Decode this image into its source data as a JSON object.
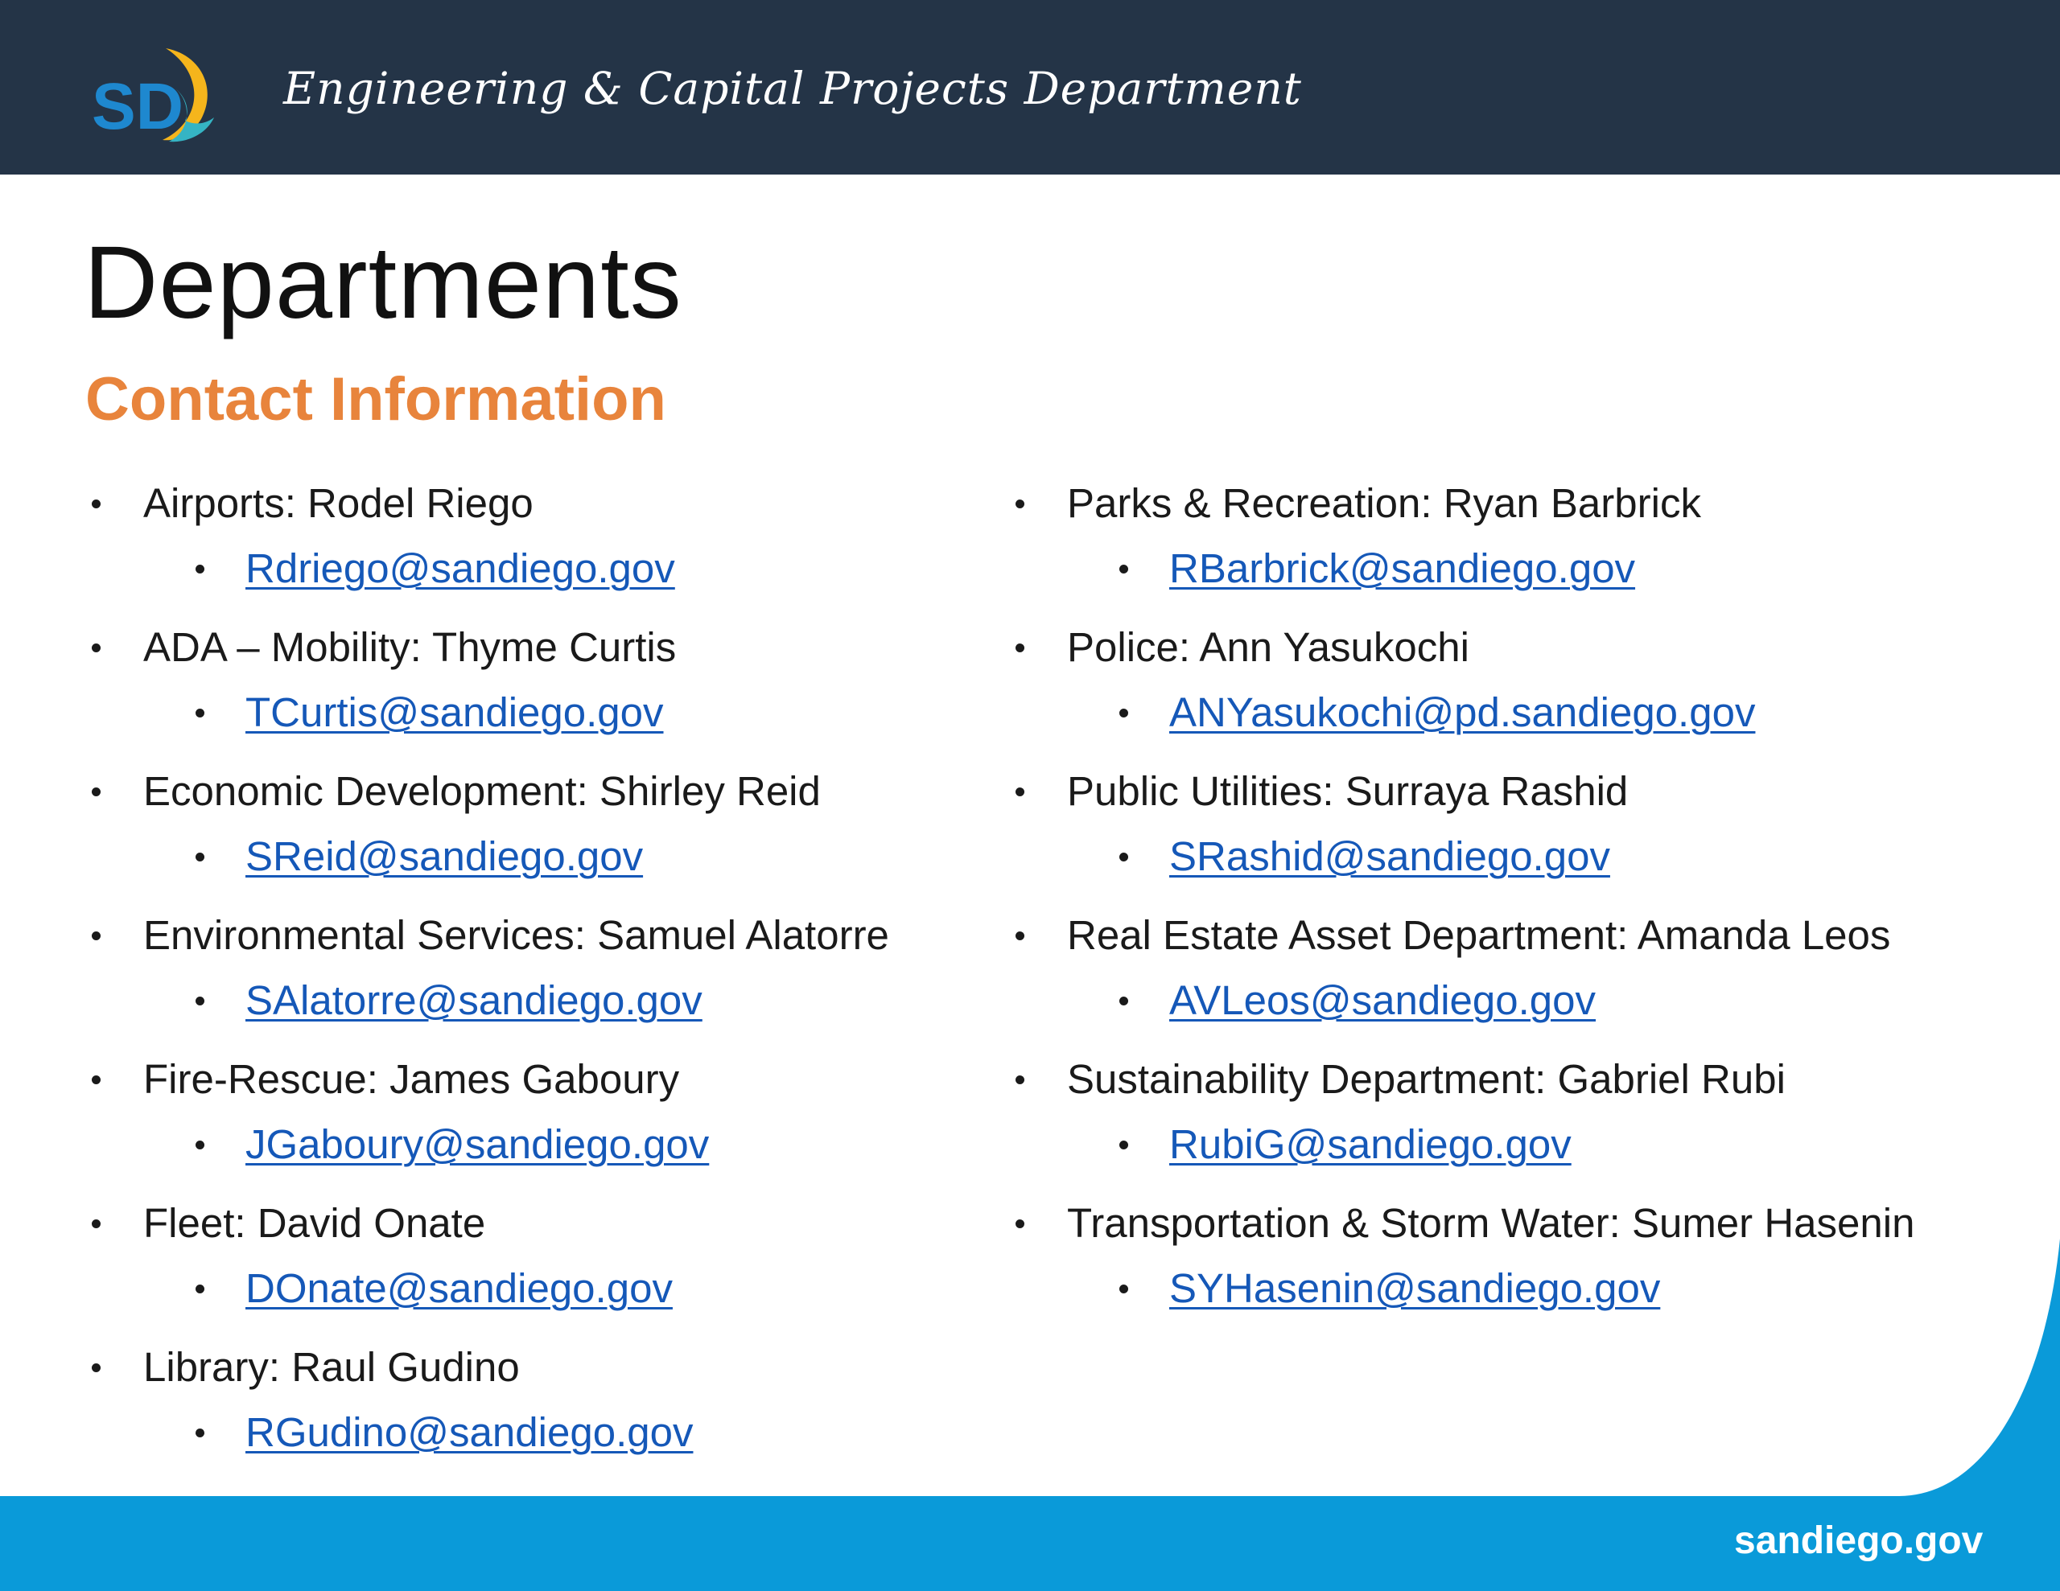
{
  "header": {
    "logo_text": "SD",
    "department": "Engineering & Capital Projects Department"
  },
  "title": "Departments",
  "subtitle": "Contact Information",
  "left_column": [
    {
      "label": "Airports: Rodel Riego",
      "email": "Rdriego@sandiego.gov"
    },
    {
      "label": "ADA – Mobility: Thyme Curtis",
      "email": "TCurtis@sandiego.gov"
    },
    {
      "label": "Economic Development: Shirley Reid",
      "email": "SReid@sandiego.gov"
    },
    {
      "label": "Environmental Services: Samuel Alatorre",
      "email": "SAlatorre@sandiego.gov"
    },
    {
      "label": "Fire-Rescue: James Gaboury",
      "email": "JGaboury@sandiego.gov"
    },
    {
      "label": "Fleet: David Onate",
      "email": "DOnate@sandiego.gov"
    },
    {
      "label": "Library: Raul Gudino",
      "email": "RGudino@sandiego.gov"
    }
  ],
  "right_column": [
    {
      "label": "Parks & Recreation: Ryan Barbrick",
      "email": "RBarbrick@sandiego.gov"
    },
    {
      "label": "Police: Ann Yasukochi",
      "email": "ANYasukochi@pd.sandiego.gov"
    },
    {
      "label": "Public Utilities: Surraya Rashid",
      "email": "SRashid@sandiego.gov"
    },
    {
      "label": "Real Estate Asset Department: Amanda Leos",
      "email": "AVLeos@sandiego.gov"
    },
    {
      "label": "Sustainability Department: Gabriel Rubi",
      "email": "RubiG@sandiego.gov"
    },
    {
      "label": "Transportation & Storm Water: Sumer Hasenin",
      "email": "SYHasenin@sandiego.gov"
    }
  ],
  "footer": {
    "site": "sandiego.gov"
  },
  "colors": {
    "header_bg": "#243447",
    "accent_orange": "#e8843c",
    "link_blue": "#1558b8",
    "footer_blue": "#0a9ad9",
    "logo_blue": "#1e88cf",
    "logo_yellow": "#f5b51c",
    "logo_teal": "#35b4c4"
  }
}
